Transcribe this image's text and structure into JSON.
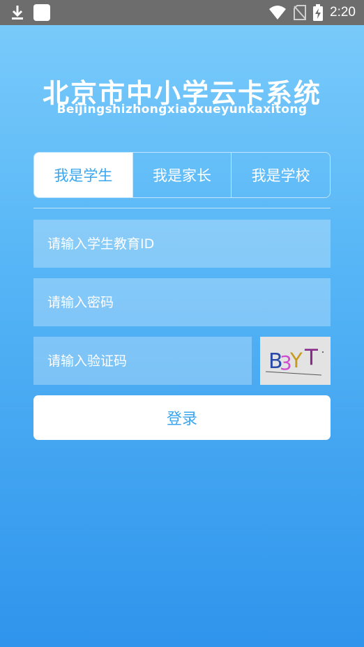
{
  "status_bar": {
    "time": "2:20",
    "left_icons": [
      "download-icon",
      "app-square-icon"
    ],
    "right_icons": [
      "wifi-icon",
      "no-sim-icon",
      "battery-charging-icon"
    ]
  },
  "header": {
    "title_cn": "北京市中小学云卡系统",
    "title_en": "Beijingshizhongxiaoxueyunkaxitong"
  },
  "tabs": [
    {
      "label": "我是学生",
      "active": true
    },
    {
      "label": "我是家长",
      "active": false
    },
    {
      "label": "我是学校",
      "active": false
    }
  ],
  "form": {
    "id_placeholder": "请输入学生教育ID",
    "password_placeholder": "请输入密码",
    "captcha_placeholder": "请输入验证码",
    "captcha_text": "B3YT",
    "login_label": "登录"
  },
  "colors": {
    "accent": "#39a6ee",
    "background_top": "#7cccfb",
    "background_bottom": "#2f94ec"
  }
}
